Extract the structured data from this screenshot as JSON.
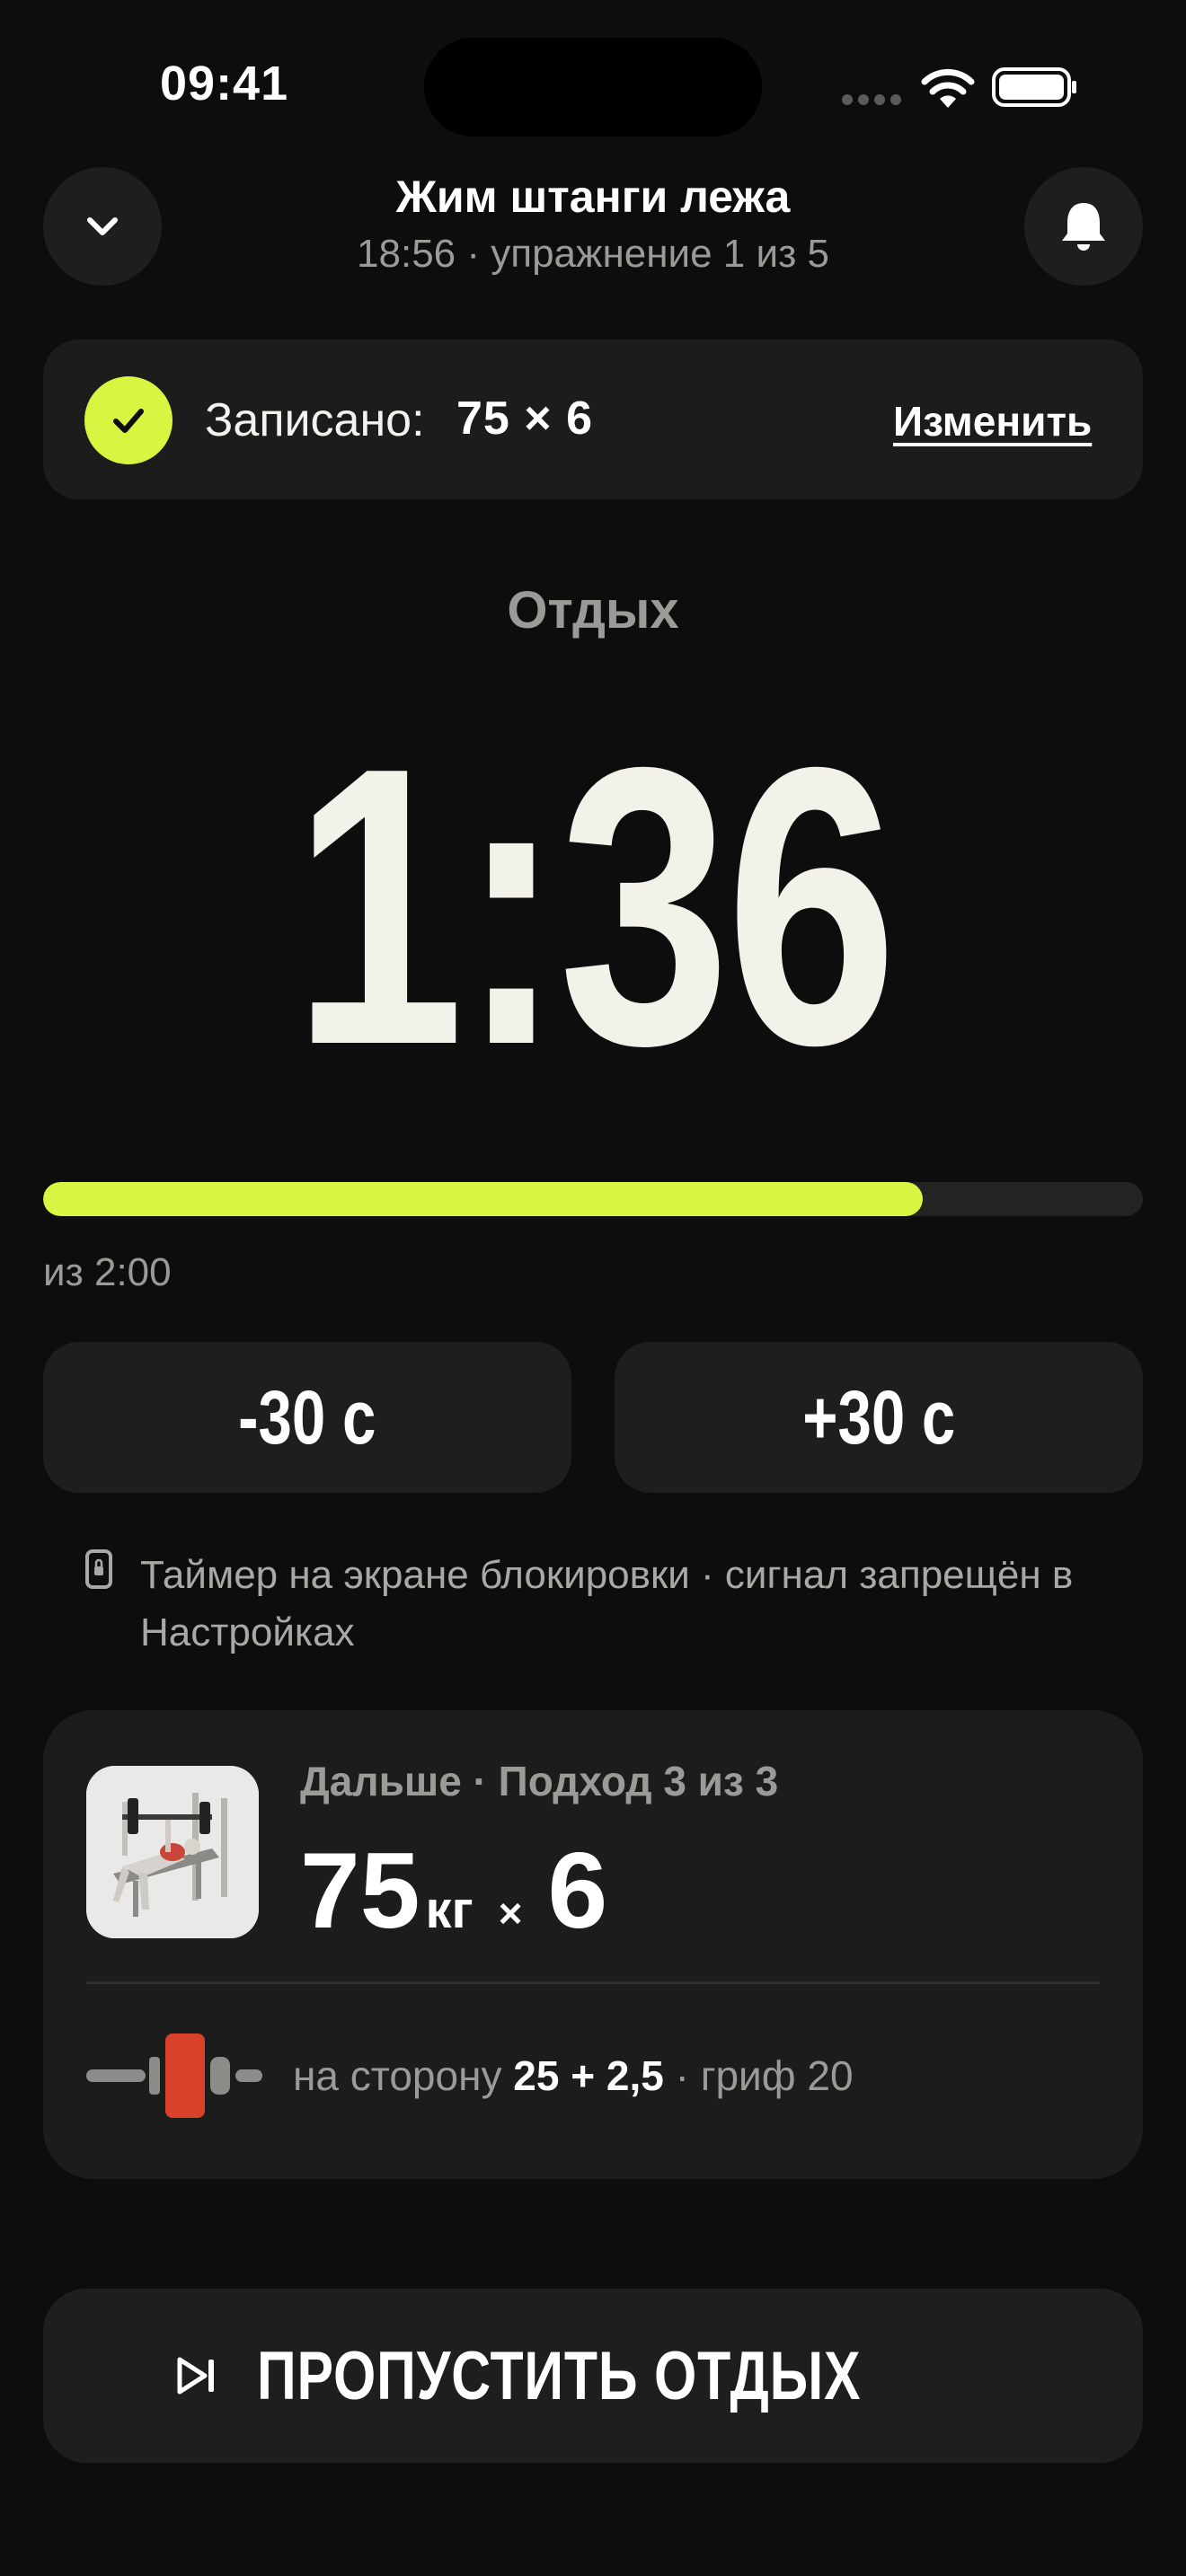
{
  "status_bar": {
    "time": "09:41"
  },
  "header": {
    "title": "Жим штанги лежа",
    "subtitle": "18:56 · упражнение 1 из 5",
    "collapse_icon": "chevron-down-icon",
    "notify_icon": "bell-icon"
  },
  "recorded": {
    "label": "Записано:",
    "value": "75 × 6",
    "edit_label": "Изменить",
    "icon": "checkmark-icon"
  },
  "rest": {
    "label": "Отдых",
    "remaining": "1:36",
    "total_label": "из 2:00",
    "progress": 0.8
  },
  "adjust": {
    "minus_label": "-30 с",
    "plus_label": "+30 с"
  },
  "lock_note": {
    "icon": "lock-icon",
    "text": "Таймер на экране блокировки · сигнал запрещён в Настройках"
  },
  "next_set": {
    "label": "Дальше · Подход 3 из 3",
    "weight": "75",
    "unit": "кг",
    "times": "×",
    "reps": "6",
    "plates_prefix": "на сторону",
    "plates_value": "25 + 2,5",
    "plates_suffix": "· гриф 20"
  },
  "skip": {
    "label": "ПРОПУСТИТЬ ОТДЫХ",
    "icon": "skip-forward-icon"
  },
  "colors": {
    "accent": "#d8f542",
    "background": "#0d0d0d",
    "card": "#1c1c1c",
    "plate": "#d9412a"
  }
}
